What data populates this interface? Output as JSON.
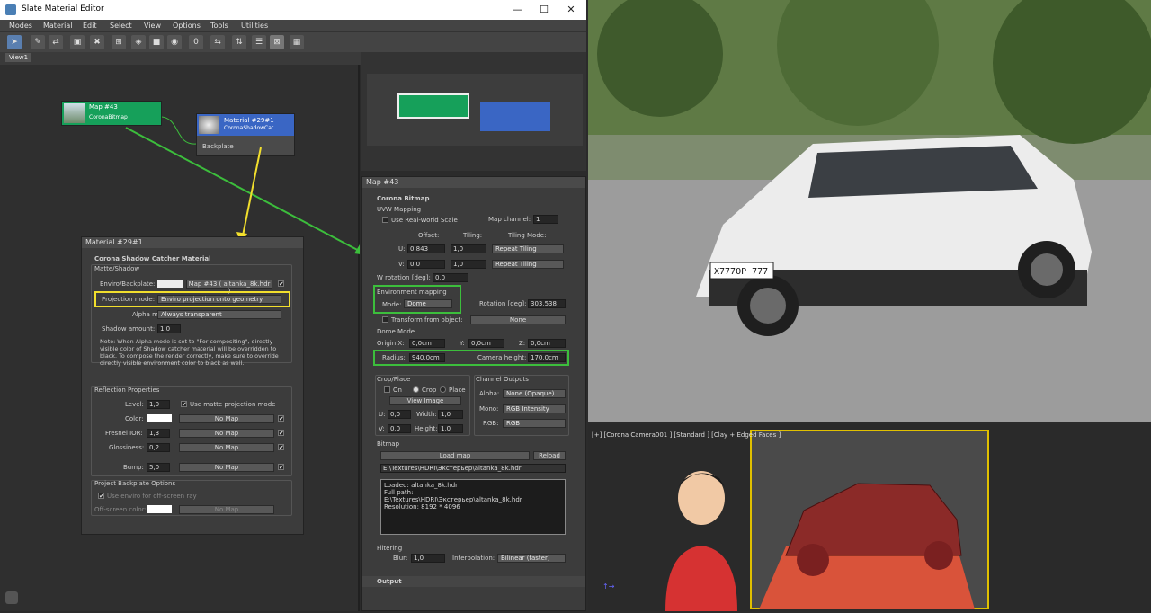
{
  "window": {
    "title": "Slate Material Editor",
    "minimize": "—",
    "maximize": "☐",
    "close": "✕"
  },
  "menu": [
    "Modes",
    "Material",
    "Edit",
    "Select",
    "View",
    "Options",
    "Tools",
    "Utilities"
  ],
  "view_tab": "View1",
  "nodes": {
    "map": {
      "title": "Map #43",
      "subtitle": "CoronaBitmap"
    },
    "material": {
      "title": "Material #29#1",
      "subtitle": "CoronaShadowCat...",
      "slot": "Backplate"
    }
  },
  "left_panel": {
    "header": "Material #29#1",
    "rollout": "Corona Shadow Catcher Material",
    "matte_group": "Matte/Shadow",
    "enviro_label": "Enviro/Backplate:",
    "enviro_map": "Map #43 ( altanka_8k.hdr )",
    "projection_label": "Projection mode:",
    "projection_value": "Enviro projection onto geometry",
    "alpha_label": "Alpha mode:",
    "alpha_value": "Always transparent",
    "shadow_label": "Shadow amount:",
    "shadow_value": "1,0",
    "note": "Note: When Alpha mode is set to \"For compositing\", directly visible color of Shadow catcher material will be overridden to black. To compose the render correctly, make sure to override directly visible environment color to black as well.",
    "refl_group": "Reflection Properties",
    "level_label": "Level:",
    "level_value": "1,0",
    "matte_proj": "Use matte projection mode",
    "color_label": "Color:",
    "color_map": "No Map",
    "fresnel_label": "Fresnel IOR:",
    "fresnel_value": "1,3",
    "fresnel_map": "No Map",
    "gloss_label": "Glossiness:",
    "gloss_value": "0,2",
    "gloss_map": "No Map",
    "bump_label": "Bump:",
    "bump_value": "5,0",
    "bump_map": "No Map",
    "backplate_group": "Project Backplate Options",
    "use_enviro": "Use enviro for off-screen ray",
    "offscreen_label": "Off-screen color:",
    "offscreen_map": "No Map"
  },
  "bitmap_panel": {
    "header": "Map #43",
    "rollout": "Corona Bitmap",
    "uvw": "UVW Mapping",
    "real_world": "Use Real-World Scale",
    "map_channel_label": "Map channel:",
    "map_channel": "1",
    "offset": "Offset:",
    "tiling": "Tiling:",
    "tiling_mode": "Tiling Mode:",
    "u": "U:",
    "v": "V:",
    "u_off": "0,843",
    "v_off": "0,0",
    "u_til": "1,0",
    "v_til": "1,0",
    "u_mode": "Repeat Tiling",
    "v_mode": "Repeat Tiling",
    "w_rot_label": "W rotation [deg]:",
    "w_rot": "0,0",
    "env_mapping": "Environment mapping",
    "mode_label": "Mode:",
    "mode_value": "Dome",
    "rotation_label": "Rotation [deg]:",
    "rotation_value": "303,538",
    "transform_label": "Transform from object:",
    "transform_value": "None",
    "dome_mode": "Dome Mode",
    "origin_x": "Origin X:",
    "ox": "0,0cm",
    "y_label": "Y:",
    "oy": "0,0cm",
    "z_label": "Z:",
    "oz": "0,0cm",
    "radius_label": "Radius:",
    "radius_value": "940,0cm",
    "cam_label": "Camera height:",
    "cam_value": "170,0cm",
    "crop_group": "Crop/Place",
    "on": "On",
    "crop": "Crop",
    "place": "Place",
    "view_image": "View Image",
    "cu": "U:",
    "cu_v": "0,0",
    "width": "Width:",
    "width_v": "1,0",
    "cv": "V:",
    "cv_v": "0,0",
    "height": "Height:",
    "height_v": "1,0",
    "channel_group": "Channel Outputs",
    "alpha": "Alpha:",
    "alpha_v": "None (Opaque)",
    "mono": "Mono:",
    "mono_v": "RGB Intensity",
    "rgb": "RGB:",
    "rgb_v": "RGB",
    "bitmap_group": "Bitmap",
    "load_map": "Load map",
    "reload": "Reload",
    "path": "E:\\Textures\\HDRI\\Экстерьер\\altanka_8k.hdr",
    "info": [
      "Loaded: altanka_8k.hdr",
      "Full path:",
      "E:\\Textures\\HDRI\\Экстерьер\\altanka_8k.hdr",
      "Resolution: 8192 * 4096"
    ],
    "filtering": "Filtering",
    "blur": "Blur:",
    "blur_v": "1,0",
    "interp": "Interpolation:",
    "interp_v": "Bilinear (faster)",
    "output": "Output"
  },
  "viewport": {
    "label": "[+] [Corona Camera001 ] [Standard ] [Clay + Edged Faces ]"
  },
  "render": {
    "plate": "X777OP 777"
  },
  "colors": {
    "yellow": "#f2df2d",
    "green": "#3cbe3c",
    "node_green": "#16a05a",
    "node_blue": "#3a66c4"
  }
}
